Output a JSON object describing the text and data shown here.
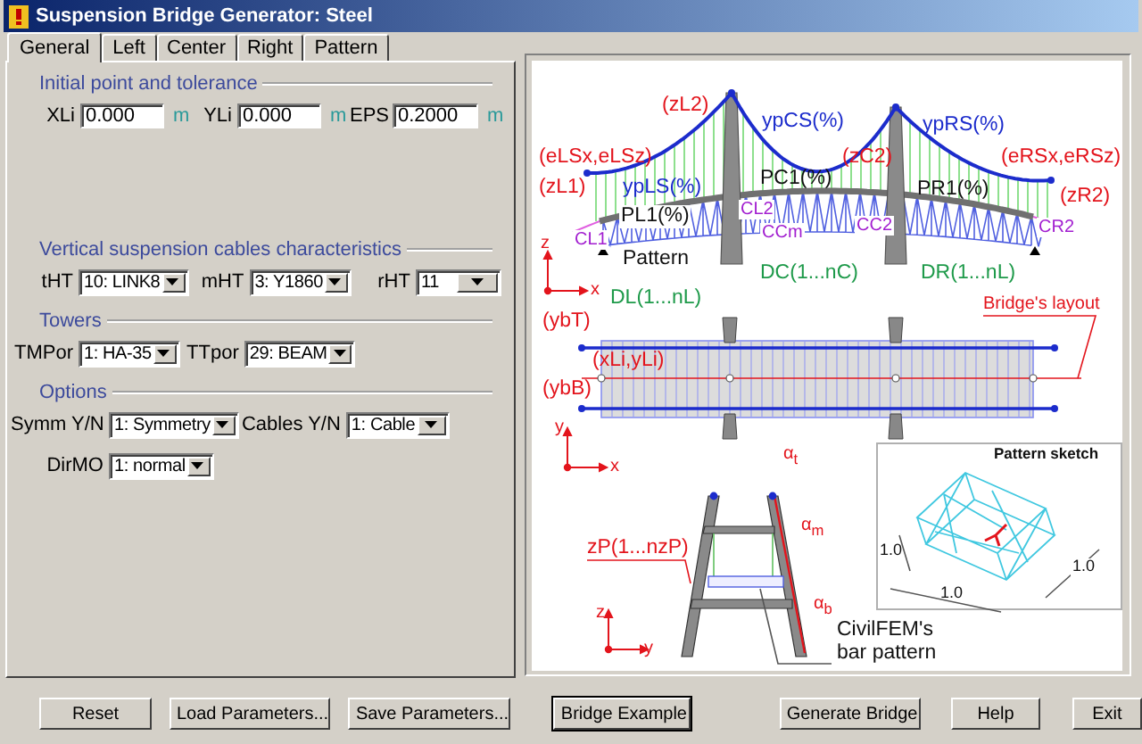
{
  "window": {
    "title": "Suspension Bridge Generator: Steel"
  },
  "tabs": [
    {
      "label": "General",
      "selected": true
    },
    {
      "label": "Left",
      "selected": false
    },
    {
      "label": "Center",
      "selected": false
    },
    {
      "label": "Right",
      "selected": false
    },
    {
      "label": "Pattern",
      "selected": false
    }
  ],
  "groups": [
    {
      "title": "Initial point and tolerance",
      "rows": [
        [
          {
            "kind": "input",
            "label": "XLi",
            "value": "0.000",
            "unit": "m"
          },
          {
            "kind": "input",
            "label": "YLi",
            "value": "0.000",
            "unit": "m"
          },
          {
            "kind": "input",
            "label": "EPS",
            "value": "0.2000",
            "unit": "m"
          }
        ]
      ]
    },
    {
      "title": "Vertical suspension cables characteristics",
      "rows": [
        [
          {
            "kind": "select",
            "label": "tHT",
            "value": "10: LINK8"
          },
          {
            "kind": "select",
            "label": "mHT",
            "value": "3: Y1860"
          },
          {
            "kind": "select",
            "label": "rHT",
            "value": "11"
          }
        ]
      ]
    },
    {
      "title": "Towers",
      "rows": [
        [
          {
            "kind": "select",
            "label": "TMPor",
            "value": "1: HA-35"
          },
          {
            "kind": "select",
            "label": "TTpor",
            "value": "29: BEAM"
          }
        ]
      ]
    },
    {
      "title": "Options",
      "rows": [
        [
          {
            "kind": "select",
            "label": "Symm Y/N",
            "value": "1: Symmetry"
          },
          {
            "kind": "select",
            "label": "Cables Y/N",
            "value": "1: Cable"
          }
        ],
        [
          {
            "kind": "select",
            "label": "DirMO",
            "value": "1: normal"
          }
        ]
      ]
    }
  ],
  "diagram": {
    "labels": [
      "(zL2)",
      "ypCS(%)",
      "ypRS(%)",
      "(eLSx,eLSz)",
      "(zC2)",
      "(eRSx,eRSz)",
      "(zL1)",
      "ypLS(%)",
      "PC1(%)",
      "PR1(%)",
      "(zR2)",
      "PL1(%)",
      "CL2",
      "CL1",
      "CCm",
      "CC2",
      "CR2",
      "Pattern",
      "DC(1...nC)",
      "DR(1...nL)",
      "DL(1...nL)",
      "Bridge's layout",
      "z",
      "x",
      "(ybT)",
      "(xLi,yLi)",
      "(ybB)",
      "y",
      "x",
      "α$_{t}$",
      "α$_{m}$",
      "α$_{b}$",
      "zP(1...nzP)",
      "z",
      "y",
      "CivilFEM's bar pattern",
      "Pattern sketch",
      "1.0",
      "1.0",
      "1.0"
    ]
  },
  "buttons": [
    {
      "label": "Reset",
      "default": false
    },
    {
      "label": "Load Parameters...",
      "default": false
    },
    {
      "label": "Save Parameters...",
      "default": false
    },
    {
      "label": "Bridge Example",
      "default": true
    },
    {
      "label": "Generate Bridge",
      "default": false
    },
    {
      "label": "Help",
      "default": false
    },
    {
      "label": "Exit",
      "default": false
    }
  ]
}
